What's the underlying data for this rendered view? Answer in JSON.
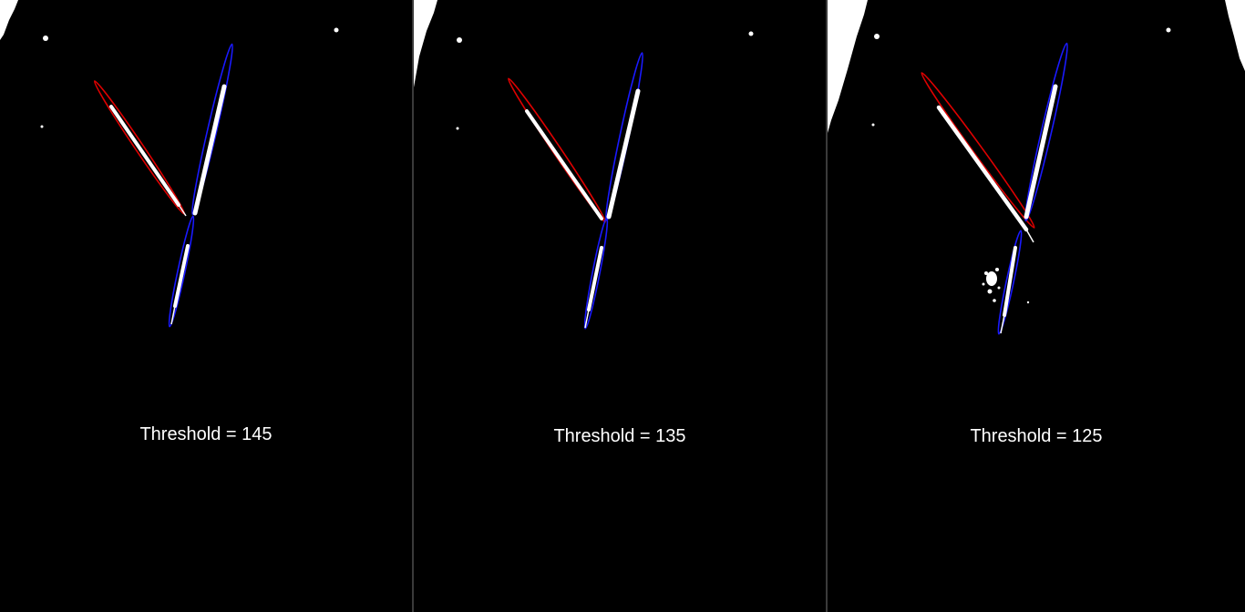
{
  "panels": [
    {
      "caption": "Threshold = 145",
      "threshold": 145
    },
    {
      "caption": "Threshold = 135",
      "threshold": 135
    },
    {
      "caption": "Threshold = 125",
      "threshold": 125
    }
  ],
  "colors": {
    "background": "#000000",
    "foreground": "#ffffff",
    "fit_red": "#e00000",
    "fit_blue": "#1a1aff"
  }
}
